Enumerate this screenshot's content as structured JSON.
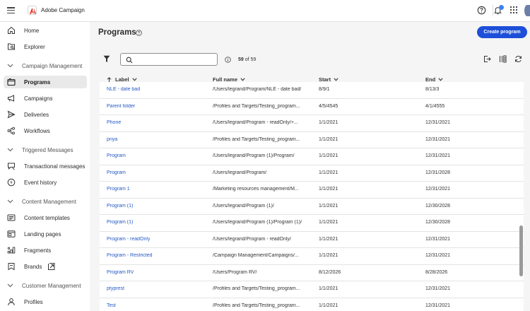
{
  "app": {
    "title": "Adobe Campaign"
  },
  "sidebar": {
    "items": [
      {
        "label": "Home",
        "icon": "home-icon"
      },
      {
        "label": "Explorer",
        "icon": "explorer-icon"
      },
      {
        "label": "Programs",
        "icon": "programs-icon"
      },
      {
        "label": "Campaigns",
        "icon": "campaigns-icon"
      },
      {
        "label": "Deliveries",
        "icon": "deliveries-icon"
      },
      {
        "label": "Workflows",
        "icon": "workflows-icon"
      },
      {
        "label": "Transactional messages",
        "icon": "transactional-icon"
      },
      {
        "label": "Event history",
        "icon": "event-history-icon"
      },
      {
        "label": "Content templates",
        "icon": "content-templates-icon"
      },
      {
        "label": "Landing pages",
        "icon": "landing-pages-icon"
      },
      {
        "label": "Fragments",
        "icon": "fragments-icon"
      },
      {
        "label": "Brands",
        "icon": "brands-icon"
      },
      {
        "label": "Profiles",
        "icon": "profiles-icon"
      }
    ],
    "sections": [
      "Campaign Management",
      "Triggered Messages",
      "Content Management",
      "Customer Management"
    ],
    "active": "Programs"
  },
  "main": {
    "title": "Programs",
    "create_button": "Create program",
    "search_placeholder": "",
    "count_current": "59",
    "count_suffix": "of 59"
  },
  "table": {
    "columns": {
      "label": "Label",
      "full_name": "Full name",
      "start": "Start",
      "end": "End"
    },
    "rows": [
      {
        "label": "NLE - date bad",
        "full_name": "/Users/legrand/Program/NLE - date bad/",
        "start": "8/9/1",
        "end": "8/13/3"
      },
      {
        "label": "Parent folder",
        "full_name": "/Profiles and Targets/Testing_program...",
        "start": "4/5/4545",
        "end": "4/1/4555"
      },
      {
        "label": "Phone",
        "full_name": "/Users/legrand/Program - readOnly/+...",
        "start": "1/1/2021",
        "end": "12/31/2021"
      },
      {
        "label": "priya",
        "full_name": "/Profiles and Targets/Testing_program...",
        "start": "1/1/2021",
        "end": "12/31/2021"
      },
      {
        "label": "Program",
        "full_name": "/Users/legrand/Program (1)/Program/",
        "start": "1/1/2021",
        "end": "12/31/2021"
      },
      {
        "label": "Program",
        "full_name": "/Users/legrand/Program/",
        "start": "1/1/2021",
        "end": "12/31/2028"
      },
      {
        "label": "Program 1",
        "full_name": "/Marketing resources management/M...",
        "start": "1/1/2021",
        "end": "12/31/2021"
      },
      {
        "label": "Program (1)",
        "full_name": "/Users/legrand/Program (1)/",
        "start": "1/1/2021",
        "end": "12/30/2028"
      },
      {
        "label": "Program (1)",
        "full_name": "/Users/legrand/Program (1)/Program (1)/",
        "start": "1/1/2021",
        "end": "12/30/2028"
      },
      {
        "label": "Program - readOnly",
        "full_name": "/Users/legrand/Program - readOnly/",
        "start": "1/1/2021",
        "end": "12/31/2021"
      },
      {
        "label": "Program - Restricted",
        "full_name": "/Campaign Management/Campaigns/...",
        "start": "1/1/2021",
        "end": "12/31/2021"
      },
      {
        "label": "Program RV",
        "full_name": "/Users/Program RV/",
        "start": "8/12/2026",
        "end": "8/28/2026"
      },
      {
        "label": "ptyprest",
        "full_name": "/Profiles and Targets/Testing_program...",
        "start": "1/1/2021",
        "end": "12/31/2021"
      },
      {
        "label": "Test",
        "full_name": "/Profiles and Targets/Testing_program...",
        "start": "1/1/2021",
        "end": "12/31/2021"
      }
    ]
  },
  "colors": {
    "accent": "#1d4fd8",
    "link": "#2559c5",
    "notification": "#3b82f6"
  }
}
